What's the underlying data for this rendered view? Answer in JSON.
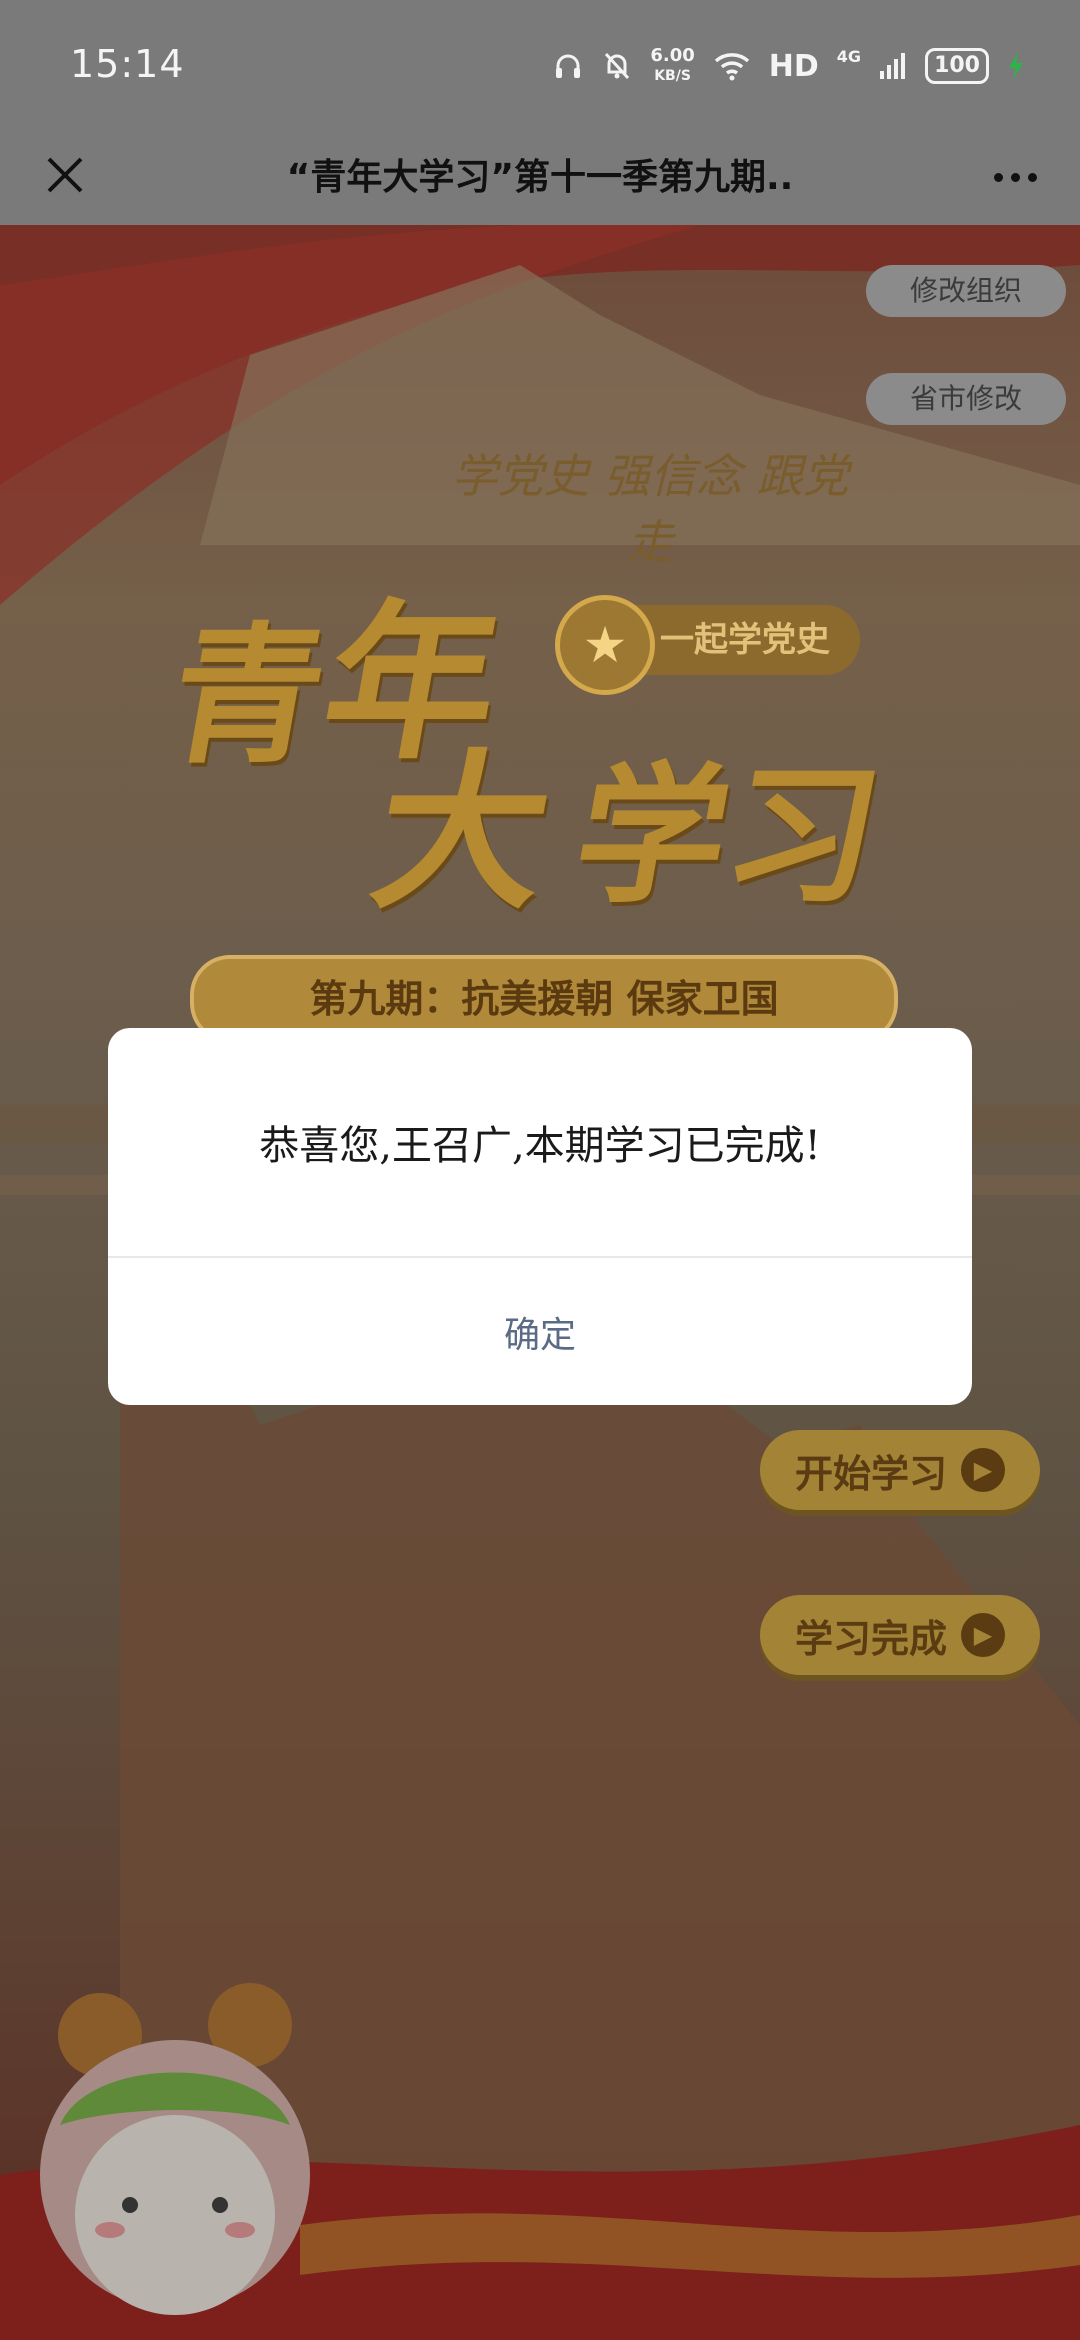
{
  "status_bar": {
    "time": "15:14",
    "speed_value": "6.00",
    "speed_unit": "KB/S",
    "hd_label": "HD",
    "network_label": "4G",
    "battery": "100"
  },
  "title_bar": {
    "title": "“青年大学习”第十一季第九期.."
  },
  "poster": {
    "edit_org_label": "修改组织",
    "edit_region_label": "省市修改",
    "calligraphy": "学党史 强信念 跟党走",
    "calligraphy_sub": "",
    "logo_chars": [
      "青",
      "年",
      "大",
      "学习"
    ],
    "slogan": "一起学党史",
    "episode": "第九期：抗美援朝 保家卫国",
    "start_button": "开始学习",
    "finish_button": "学习完成"
  },
  "modal": {
    "message": "恭喜您,王召广,本期学习已完成!",
    "ok_label": "确定"
  },
  "colors": {
    "overlay": "#7a7a7a",
    "gold": "#b58a30",
    "modal_link": "#5b6b85"
  }
}
